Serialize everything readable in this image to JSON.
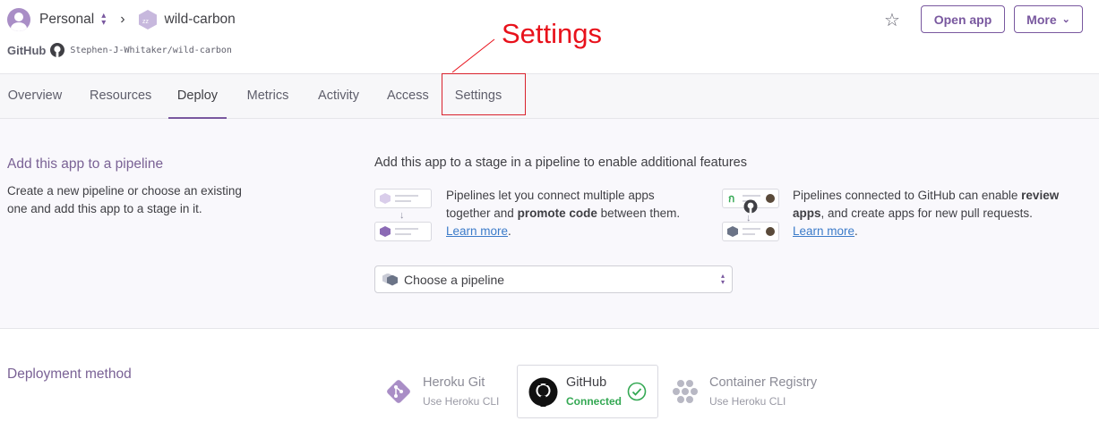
{
  "header": {
    "account": "Personal",
    "app_name": "wild-carbon",
    "github_label": "GitHub",
    "github_repo": "Stephen-J-Whitaker/wild-carbon",
    "open_app": "Open app",
    "more": "More"
  },
  "annotation": {
    "text": "Settings",
    "color": "#e8111b"
  },
  "nav": {
    "tabs": [
      {
        "label": "Overview"
      },
      {
        "label": "Resources"
      },
      {
        "label": "Deploy"
      },
      {
        "label": "Metrics"
      },
      {
        "label": "Activity"
      },
      {
        "label": "Access"
      },
      {
        "label": "Settings"
      }
    ],
    "active": "Deploy"
  },
  "pipeline": {
    "title": "Add this app to a pipeline",
    "description": "Create a new pipeline or choose an existing one and add this app to a stage in it.",
    "heading": "Add this app to a stage in a pipeline to enable additional features",
    "feature1": {
      "text_a": "Pipelines let you connect multiple apps together and ",
      "bold": "promote code",
      "text_b": " between them.",
      "link": "Learn more"
    },
    "feature2": {
      "text_a": "Pipelines connected to GitHub can enable ",
      "bold": "review apps",
      "text_b": ", and create apps for new pull requests.",
      "link": "Learn more"
    },
    "select_placeholder": "Choose a pipeline"
  },
  "deployment": {
    "title": "Deployment method",
    "methods": [
      {
        "name": "Heroku Git",
        "sub": "Use Heroku CLI"
      },
      {
        "name": "GitHub",
        "sub": "Connected"
      },
      {
        "name": "Container Registry",
        "sub": "Use Heroku CLI"
      }
    ]
  },
  "colors": {
    "accent": "#79589f",
    "connected": "#34a853",
    "link": "#3c7bc9",
    "annotation": "#e8111b"
  }
}
